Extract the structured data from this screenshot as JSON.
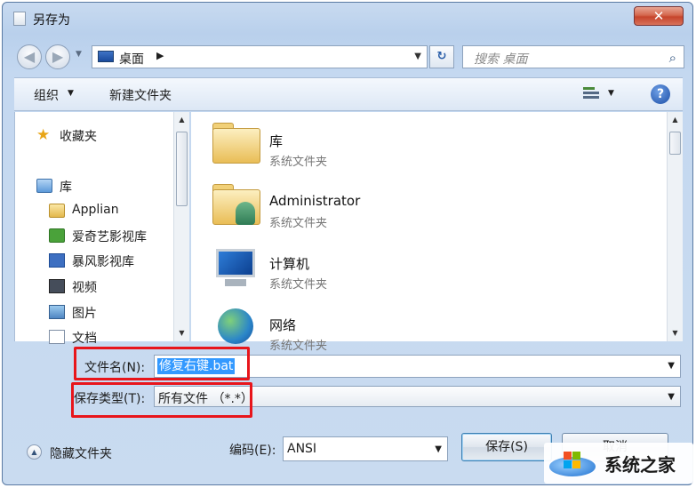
{
  "window": {
    "title": "另存为",
    "close_glyph": "✕"
  },
  "nav": {
    "back_glyph": "◀",
    "forward_glyph": "▶",
    "address": "桌面",
    "address_separator": "▶",
    "refresh_glyph": "↻",
    "search_placeholder": "搜索 桌面",
    "search_glyph": "⌕"
  },
  "toolbar": {
    "organize_label": "组织",
    "new_folder_label": "新建文件夹",
    "help_glyph": "?"
  },
  "sidebar": {
    "items": [
      {
        "label": "收藏夹",
        "icon": "star-icon"
      },
      {
        "label": "库",
        "icon": "library-icon"
      },
      {
        "label": "Applian",
        "icon": "folder-icon"
      },
      {
        "label": "爱奇艺影视库",
        "icon": "iqiyi-icon"
      },
      {
        "label": "暴风影视库",
        "icon": "baofeng-icon"
      },
      {
        "label": "视频",
        "icon": "video-library-icon"
      },
      {
        "label": "图片",
        "icon": "pictures-library-icon"
      },
      {
        "label": "文档",
        "icon": "documents-library-icon"
      }
    ]
  },
  "files": [
    {
      "name": "库",
      "type": "系统文件夹",
      "icon": "library-folder-icon"
    },
    {
      "name": "Administrator",
      "type": "系统文件夹",
      "icon": "user-folder-icon"
    },
    {
      "name": "计算机",
      "type": "系统文件夹",
      "icon": "computer-icon"
    },
    {
      "name": "网络",
      "type": "系统文件夹",
      "icon": "network-icon"
    }
  ],
  "form": {
    "filename_label": "文件名(N):",
    "filename_value": "修复右键.bat",
    "filetype_label": "保存类型(T):",
    "filetype_value": "所有文件 （*.*）",
    "highlight_color": "#e8151b"
  },
  "footer": {
    "hide_folders_label": "隐藏文件夹",
    "encoding_label": "编码(E):",
    "encoding_value": "ANSI",
    "save_label": "保存(S)",
    "cancel_label": "取消"
  },
  "watermark": {
    "text": "系统之家"
  }
}
